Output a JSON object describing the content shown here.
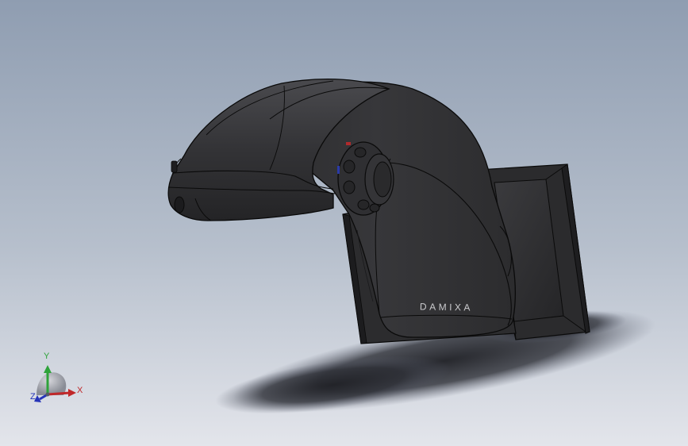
{
  "model": {
    "brand_text": "DAMIXA"
  },
  "triad": {
    "x_label": "X",
    "y_label": "Y",
    "z_label": "Z"
  },
  "colors": {
    "background_top": "#8e9cb0",
    "background_bottom": "#e2e4ea",
    "body_dark": "#2b2b2d",
    "body_mid": "#3a3a3d",
    "edge_line": "#0a0a0a",
    "axis_x": "#c0282a",
    "axis_y": "#2ea33a",
    "axis_z": "#2634b8"
  }
}
